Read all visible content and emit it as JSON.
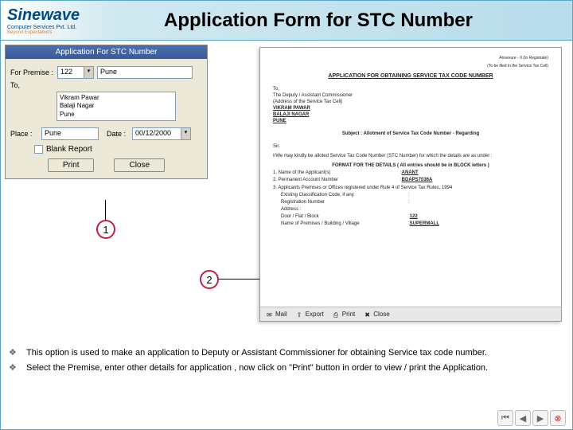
{
  "logo": {
    "main": "Sinewave",
    "sub": "Computer Services Pvt. Ltd.",
    "tag": "Beyond Expectations"
  },
  "title": "Application Form for STC Number",
  "dialog": {
    "title": "Application For STC Number",
    "premise_label": "For Premise :",
    "premise_code": "122",
    "premise_city": "Pune",
    "to_label": "To,",
    "to_lines": [
      "Vikram Pawar",
      "Balaji Nagar",
      "Pune"
    ],
    "place_label": "Place :",
    "place_value": "Pune",
    "date_label": "Date :",
    "date_value": "00/12/2000",
    "blank_label": "Blank Report",
    "print": "Print",
    "close": "Close"
  },
  "preview": {
    "annex": "Annexure - II\n(to Registrate)",
    "cell_note": "(To be filed in the Service Tax Cell)",
    "title": "APPLICATION FOR OBTAINING SERVICE TAX CODE NUMBER",
    "to": "To,",
    "to1": "The Deputy / Assistant Commissioner",
    "to2": "(Address of the Service Tax Cell)",
    "addr1": "VIKRAM PAWAR",
    "addr2": "BALAJI NAGAR",
    "addr3": "PUNE",
    "subject": "Subject : Allotment of Service Tax Code Number - Regarding",
    "sir": "Sir,",
    "body": "I/We may kindly be alloted Service Tax Code Number (STC Number) for which the details are as under :",
    "format": "FORMAT FOR THE DETAILS ( All entries should be in BLOCK letters )",
    "f1_label": "1. Name of the Applicant(s)",
    "f1_val": "ANANT",
    "f2_label": "2. Permanent Account Number",
    "f2_val": "BDAPS7036A",
    "f3_label": "3. Applicants Premises or Offices registered under Rule 4 of Service Tax Rules, 1994",
    "f3a_label": "Existing Classification Code, if any",
    "f3b_label": "Registration Number",
    "f3c_label": "Address :",
    "f3d_label": "Door / Flat / Block",
    "f3d_val": "122",
    "f3e_label": "Name of Premises / Building / Village",
    "f3e_val": "SUPERMALL",
    "toolbar": {
      "mail": "Mail",
      "export": "Export",
      "print": "Print",
      "close": "Close"
    }
  },
  "callouts": {
    "one": "1",
    "two": "2"
  },
  "bullets": {
    "b1": "This option is used to make an application to Deputy or Assistant Commissioner for obtaining Service tax code number.",
    "b2": "Select the Premise, enter other details for application , now click on \"Print\" button in order to view / print the Application."
  }
}
